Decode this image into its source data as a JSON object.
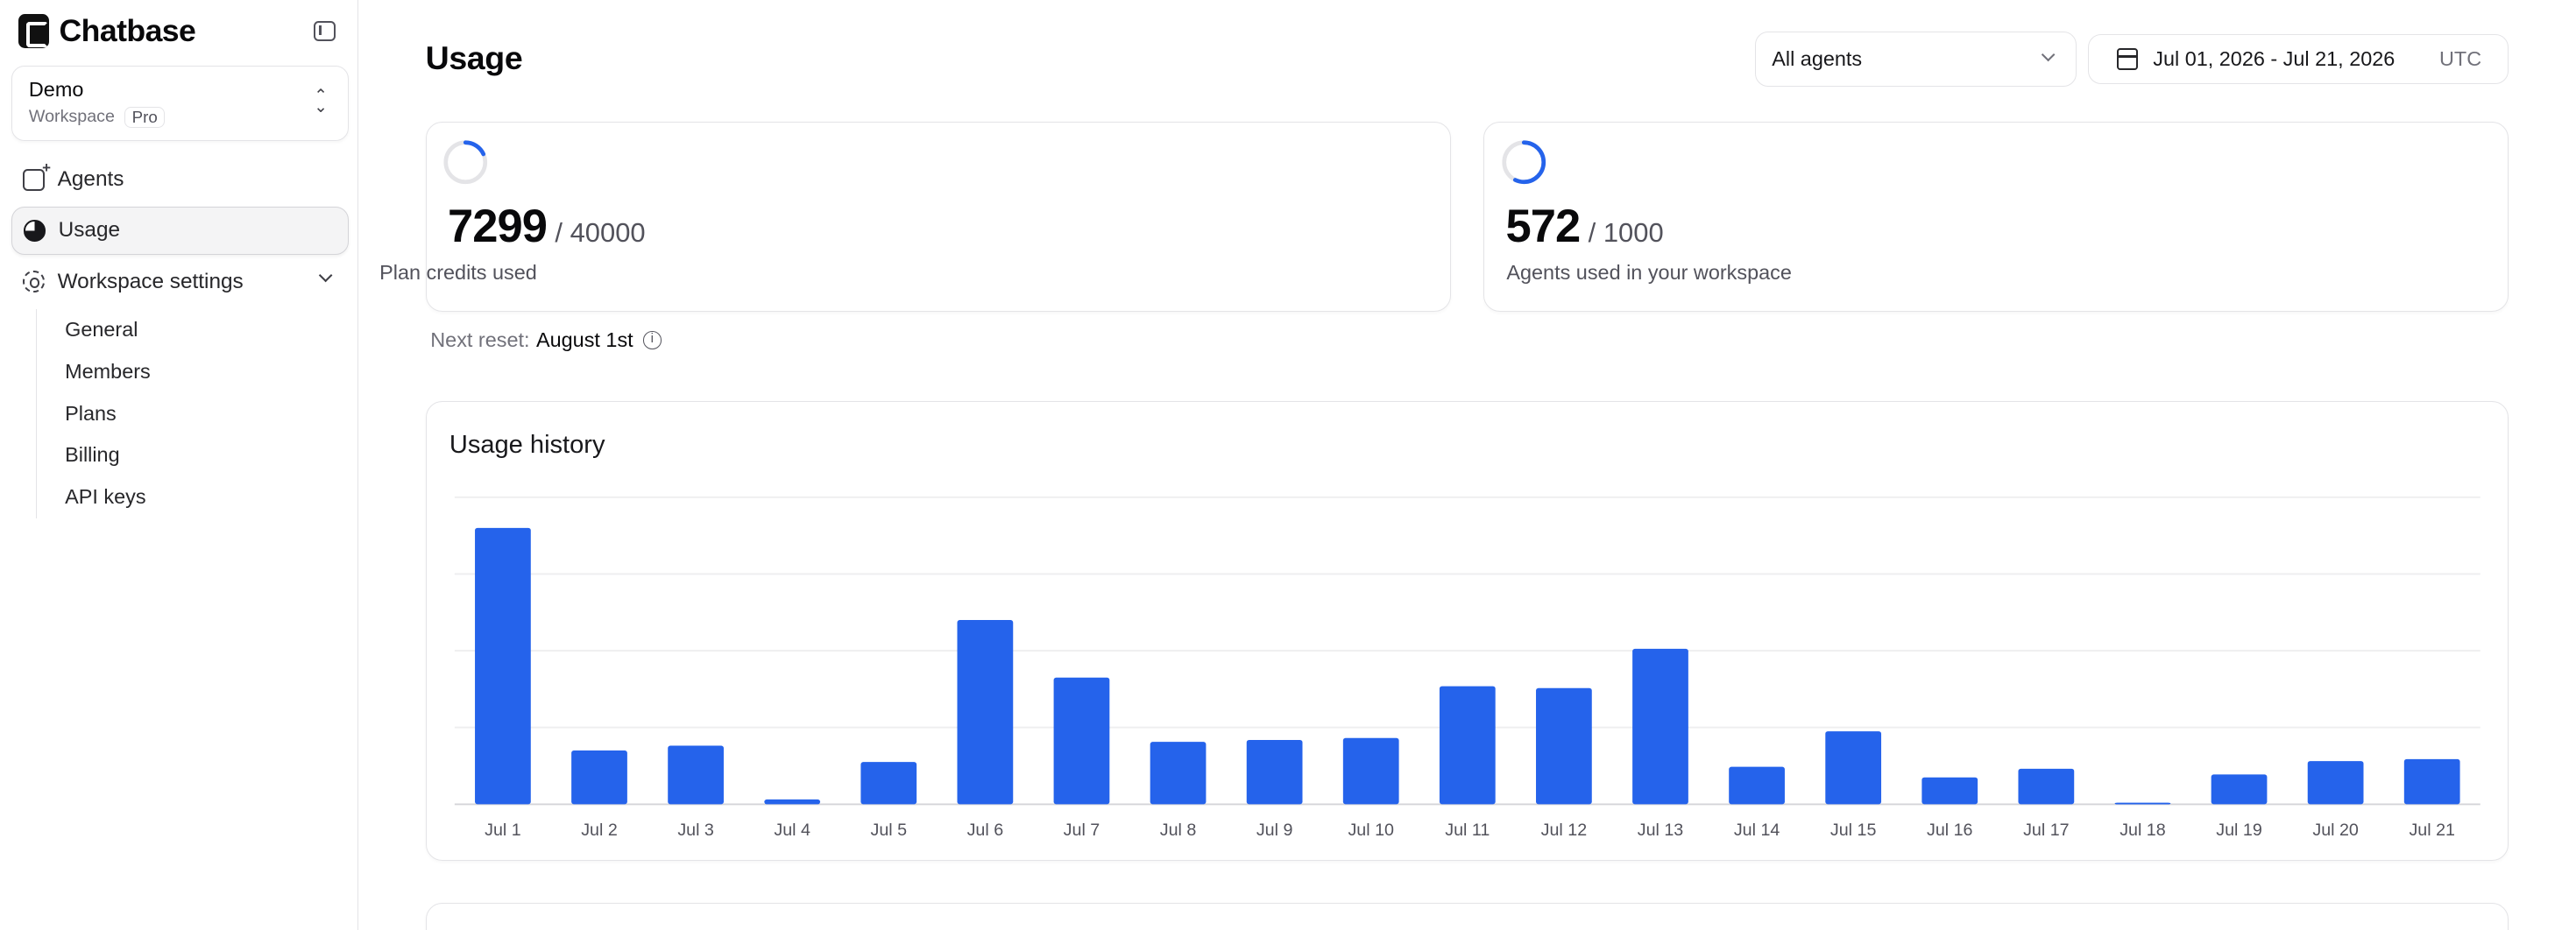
{
  "brand": {
    "name": "Chatbase"
  },
  "workspace": {
    "name": "Demo",
    "type": "Workspace",
    "plan": "Pro"
  },
  "nav": {
    "agents": "Agents",
    "usage": "Usage",
    "workspace_settings": "Workspace settings",
    "sub_items": [
      "General",
      "Members",
      "Plans",
      "Billing",
      "API keys"
    ]
  },
  "page": {
    "title": "Usage"
  },
  "filters": {
    "agent_select": "All agents",
    "date_range": "Jul 01, 2026 - Jul 21, 2026",
    "timezone": "UTC"
  },
  "stats": {
    "credits": {
      "used": "7299",
      "total": "/ 40000",
      "label": "Plan credits used",
      "fraction": 0.182
    },
    "agents": {
      "used": "572",
      "total": "/ 1000",
      "label": "Agents used in your workspace",
      "fraction": 0.572
    }
  },
  "next_reset": {
    "label": "Next reset:",
    "date": "August 1st"
  },
  "usage_history": {
    "title": "Usage history"
  },
  "colors": {
    "accent": "#2563eb",
    "ring_track": "#e4e4e7"
  },
  "chart_data": {
    "type": "bar",
    "categories": [
      "Jul 1",
      "Jul 2",
      "Jul 3",
      "Jul 4",
      "Jul 5",
      "Jul 6",
      "Jul 7",
      "Jul 8",
      "Jul 9",
      "Jul 10",
      "Jul 11",
      "Jul 12",
      "Jul 13",
      "Jul 14",
      "Jul 15",
      "Jul 16",
      "Jul 17",
      "Jul 18",
      "Jul 19",
      "Jul 20",
      "Jul 21"
    ],
    "values": [
      1440,
      280,
      305,
      25,
      220,
      960,
      660,
      325,
      335,
      345,
      615,
      605,
      810,
      195,
      380,
      140,
      185,
      8,
      155,
      225,
      235
    ],
    "ylim": [
      0,
      1600
    ],
    "grid": true,
    "gridlines": 4,
    "y_tick_labels_shown": false,
    "title": "Usage history"
  }
}
